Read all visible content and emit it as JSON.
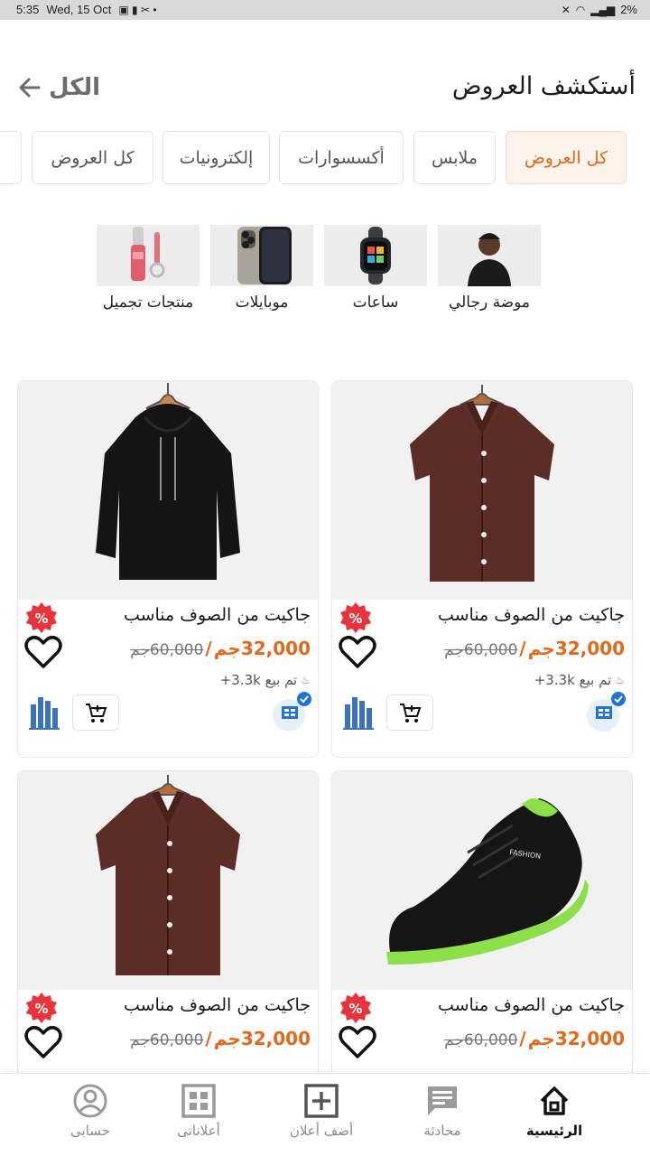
{
  "status_bar": {
    "time": "5:35",
    "date": "Wed, 15 Oct",
    "battery": "2%"
  },
  "header": {
    "title": "أستكشف العروض",
    "see_all": "الكل"
  },
  "tabs": [
    {
      "label": "كل العروض",
      "active": true
    },
    {
      "label": "ملابس",
      "active": false
    },
    {
      "label": "أكسسوارات",
      "active": false
    },
    {
      "label": "إلكترونيات",
      "active": false
    },
    {
      "label": "كل العروض",
      "active": false
    }
  ],
  "categories": [
    {
      "label": "موضة رجالي",
      "icon": "man-portrait-icon"
    },
    {
      "label": "ساعات",
      "icon": "smartwatch-icon"
    },
    {
      "label": "موبايلات",
      "icon": "smartphone-icon"
    },
    {
      "label": "منتجات تجميل",
      "icon": "lipgloss-icon"
    }
  ],
  "products": [
    {
      "title": "جاكيت من الصوف مناسب",
      "price_now": "32,000جم",
      "price_old": "60,000جم",
      "separator": "/",
      "sold": "تم بيع 3.3k+",
      "image": "brown-shirt-icon"
    },
    {
      "title": "جاكيت من الصوف مناسب",
      "price_now": "32,000جم",
      "price_old": "60,000جم",
      "separator": "/",
      "sold": "تم بيع 3.3k+",
      "image": "black-hoodie-icon"
    },
    {
      "title": "جاكيت من الصوف مناسب",
      "price_now": "32,000جم",
      "price_old": "60,000جم",
      "separator": "/",
      "image": "sneaker-icon"
    },
    {
      "title": "جاكيت من الصوف مناسب",
      "price_now": "32,000جم",
      "price_old": "60,000جم",
      "separator": "/",
      "image": "brown-shirt-icon"
    }
  ],
  "bottom_nav": [
    {
      "label": "الرئيسية",
      "icon": "home-icon",
      "active": true
    },
    {
      "label": "محادثة",
      "icon": "chat-icon",
      "active": false
    },
    {
      "label": "أضف أعلان",
      "icon": "add-box-icon",
      "active": false
    },
    {
      "label": "أعلاناتى",
      "icon": "grid-icon",
      "active": false
    },
    {
      "label": "حسابى",
      "icon": "account-icon",
      "active": false
    }
  ],
  "colors": {
    "accent": "#e4681c",
    "badge_red": "#e8333b",
    "verified_blue": "#1e73d8"
  }
}
